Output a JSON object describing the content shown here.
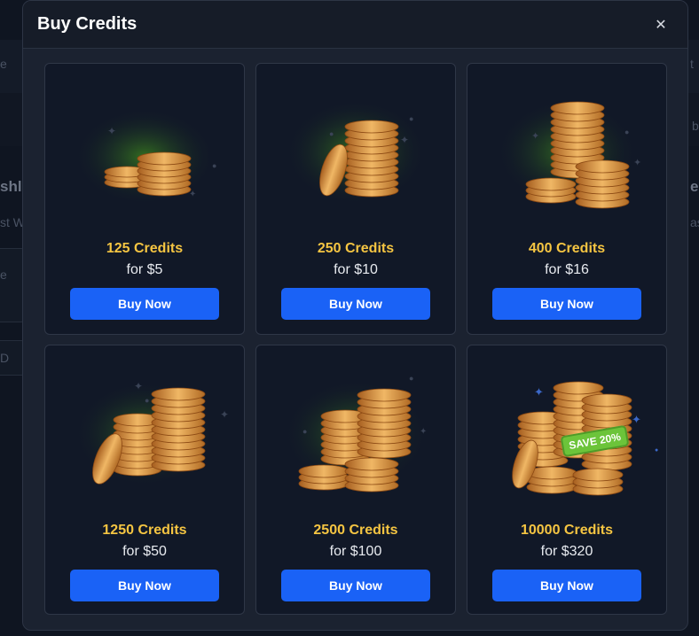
{
  "modal": {
    "title": "Buy Credits",
    "close_icon": "close-icon"
  },
  "background_fragments": [
    "e",
    "t",
    "b",
    "shl",
    "e",
    "st W",
    "ast",
    "e",
    "D"
  ],
  "packages": [
    {
      "credits": "125 Credits",
      "price": "for $5",
      "button": "Buy Now",
      "icon": "coin-stack-icon"
    },
    {
      "credits": "250 Credits",
      "price": "for $10",
      "button": "Buy Now",
      "icon": "coin-stack-icon"
    },
    {
      "credits": "400 Credits",
      "price": "for $16",
      "button": "Buy Now",
      "icon": "coin-stack-icon"
    },
    {
      "credits": "1250 Credits",
      "price": "for $50",
      "button": "Buy Now",
      "icon": "coin-stack-icon"
    },
    {
      "credits": "2500 Credits",
      "price": "for $100",
      "button": "Buy Now",
      "icon": "coin-stack-icon"
    },
    {
      "credits": "10000 Credits",
      "price": "for $320",
      "button": "Buy Now",
      "icon": "coin-stack-icon",
      "badge": "SAVE 20%"
    }
  ],
  "colors": {
    "accent": "#1a62f6",
    "credits_text": "#f5c542",
    "coin": "#d98b3a",
    "glow": "#3c7a1e",
    "badge": "#6cc43a"
  }
}
